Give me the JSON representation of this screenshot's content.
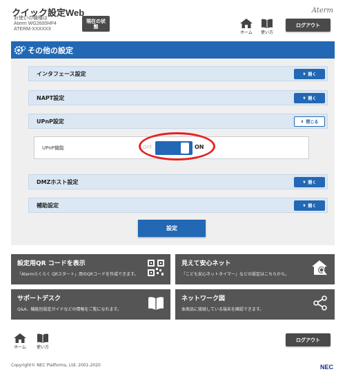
{
  "header": {
    "app_title": "クイック設定Web",
    "device_label": "お使いの機種は",
    "device_model": "Aterm WG2600HP4",
    "device_id": "ATERM-XXXXXX",
    "status_button": "現在の状態",
    "brand": "Aterm",
    "nav_home": "ホーム",
    "nav_manual": "使い方",
    "logout": "ログアウト"
  },
  "section": {
    "title": "その他の設定"
  },
  "accordions": [
    {
      "label": "インタフェース設定",
      "button": "開く",
      "state": "closed"
    },
    {
      "label": "NAPT設定",
      "button": "開く",
      "state": "closed"
    },
    {
      "label": "UPnP設定",
      "button": "閉じる",
      "state": "open"
    },
    {
      "label": "DMZホスト設定",
      "button": "開く",
      "state": "closed"
    },
    {
      "label": "補助設定",
      "button": "開く",
      "state": "closed"
    }
  ],
  "upnp": {
    "label": "UPnP機能",
    "off_label": "OFF",
    "on_label": "ON",
    "value": "ON"
  },
  "apply_button": "設定",
  "tiles": [
    {
      "title": "設定用QR コードを表示",
      "desc": "「Atermらくらく QRスタート」用のQRコードを作成できます。",
      "icon": "qr-code-icon"
    },
    {
      "title": "見えて安心ネット",
      "desc": "「こども安心ネットタイマー」などの設定はこちらから。",
      "icon": "home-search-icon"
    },
    {
      "title": "サポートデスク",
      "desc": "Q&A、機能別設定ガイドなどの情報をご覧になれます。",
      "icon": "book-icon"
    },
    {
      "title": "ネットワーク図",
      "desc": "本商品に接続している端末を確認できます。",
      "icon": "share-network-icon"
    }
  ],
  "footer": {
    "nav_home": "ホーム",
    "nav_manual": "使い方",
    "logout": "ログアウト",
    "copyright": "Copyright© NEC Platforms, Ltd. 2001-2020",
    "brand": "NEC"
  },
  "colors": {
    "primary_blue": "#2268b4",
    "accordion_bg": "#dbe7f3",
    "tile_bg": "#555555",
    "highlight_red": "#e52222"
  }
}
